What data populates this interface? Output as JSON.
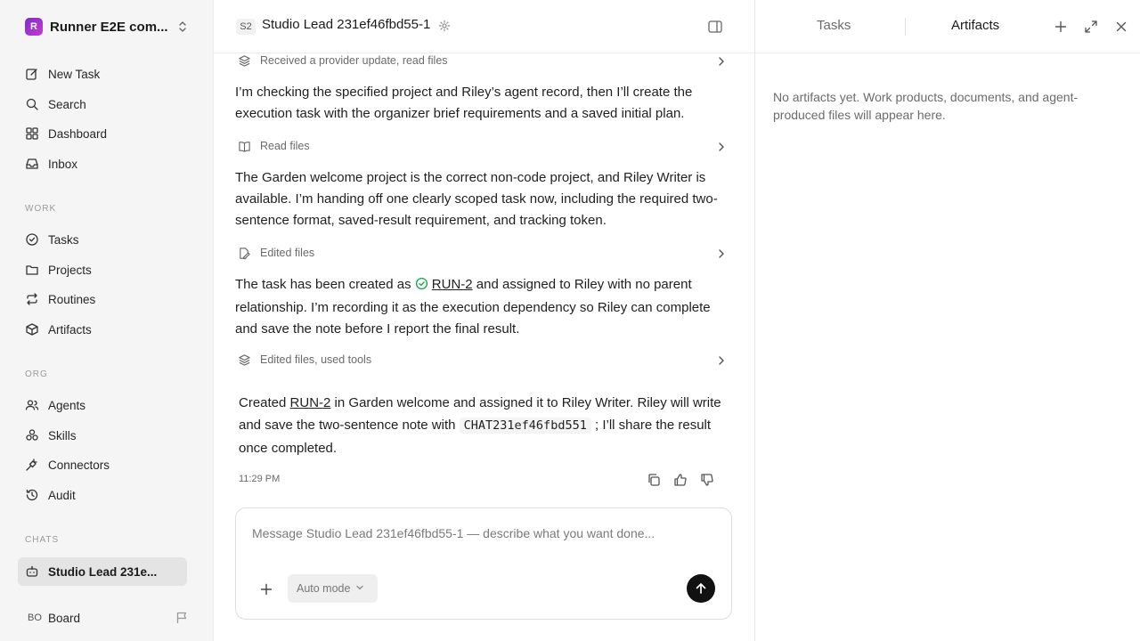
{
  "workspace": {
    "initial": "R",
    "name": "Runner E2E com..."
  },
  "nav": {
    "main": [
      {
        "label": "New Task",
        "icon": "edit-icon"
      },
      {
        "label": "Search",
        "icon": "search-icon"
      },
      {
        "label": "Dashboard",
        "icon": "dashboard-icon"
      },
      {
        "label": "Inbox",
        "icon": "inbox-icon"
      }
    ],
    "work_label": "WORK",
    "work": [
      {
        "label": "Tasks",
        "icon": "check-circle-icon"
      },
      {
        "label": "Projects",
        "icon": "folder-icon"
      },
      {
        "label": "Routines",
        "icon": "repeat-icon"
      },
      {
        "label": "Artifacts",
        "icon": "box-icon"
      }
    ],
    "org_label": "ORG",
    "org": [
      {
        "label": "Agents",
        "icon": "users-icon"
      },
      {
        "label": "Skills",
        "icon": "skills-icon"
      },
      {
        "label": "Connectors",
        "icon": "plug-icon"
      },
      {
        "label": "Audit",
        "icon": "history-icon"
      }
    ],
    "chats_label": "CHATS",
    "chat_active": "Studio Lead 231e..."
  },
  "board": {
    "initials": "BO",
    "label": "Board"
  },
  "header": {
    "badge": "S2",
    "agent_name": "Studio Lead 231ef46fbd55-1"
  },
  "thread": {
    "tool1": "Received a provider update, read files",
    "msg1": "I’m checking the specified project and Riley’s agent record, then I’ll create the execution task with the organizer brief requirements and a saved initial plan.",
    "tool2": "Read files",
    "msg2": "The Garden welcome project is the correct non-code project, and Riley Writer is available. I’m handing off one clearly scoped task now, including the required two-sentence format, saved-result requirement, and tracking token.",
    "tool3": "Edited files",
    "msg3_pre": "The task has been created as ",
    "msg3_link": "RUN-2",
    "msg3_post": " and assigned to Riley with no parent relationship. I’m recording it as the execution dependency so Riley can complete and save the note before I report the final result.",
    "tool4": "Edited files, used tools",
    "final_pre": "Created ",
    "final_link": "RUN-2",
    "final_mid": " in Garden welcome and assigned it to Riley Writer. Riley will write and save the two-sentence note with ",
    "final_code": "CHAT231ef46fbd551",
    "final_post": " ; I’ll share the result once completed.",
    "timestamp": "11:29 PM"
  },
  "composer": {
    "placeholder": "Message Studio Lead 231ef46fbd55-1 — describe what you want done...",
    "mode": "Auto mode"
  },
  "right_panel": {
    "tab_tasks": "Tasks",
    "tab_artifacts": "Artifacts",
    "active_tab": "Artifacts",
    "empty": "No artifacts yet. Work products, documents, and agent-produced files will appear here."
  }
}
